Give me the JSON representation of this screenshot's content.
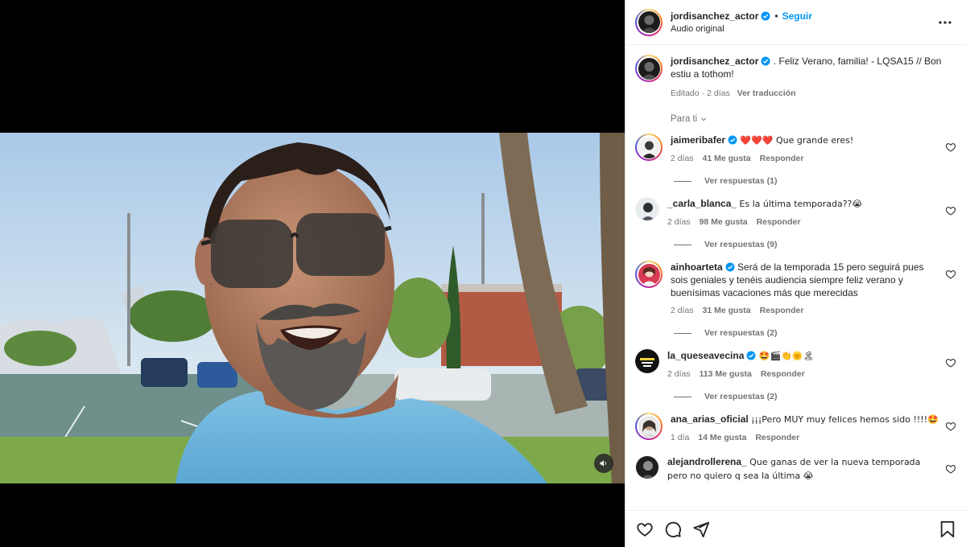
{
  "post": {
    "author": "jordisanchez_actor",
    "follow_label": "Seguir",
    "separator": "•",
    "audio": "Audio original",
    "caption": {
      "username": "jordisanchez_actor",
      "text": ". Feliz Verano, familia! - LQSA15 // Bon estiu a tothom!",
      "edited": "Editado",
      "time": "2 días",
      "translate": "Ver traducción"
    },
    "filter_label": "Para ti"
  },
  "comments": [
    {
      "username": "jaimeribafer",
      "verified": true,
      "text": "❤️❤️❤️ Que grande eres!",
      "time": "2 días",
      "likes": "41 Me gusta",
      "reply": "Responder",
      "replies": "Ver respuestas (1)"
    },
    {
      "username": "_carla_blanca_",
      "verified": false,
      "text": "Es la última temporada??😭",
      "time": "2 días",
      "likes": "98 Me gusta",
      "reply": "Responder",
      "replies": "Ver respuestas (9)"
    },
    {
      "username": "ainhoarteta",
      "verified": true,
      "text": "Será de la temporada 15 pero seguirá pues sois geniales y tenéis audiencia siempre feliz verano y buenísimas vacaciones más que merecidas",
      "time": "2 días",
      "likes": "31 Me gusta",
      "reply": "Responder",
      "replies": "Ver respuestas (2)"
    },
    {
      "username": "la_queseavecina",
      "verified": true,
      "text": "🤩🎬👏🌞🏝",
      "time": "2 días",
      "likes": "113 Me gusta",
      "reply": "Responder",
      "replies": "Ver respuestas (2)"
    },
    {
      "username": "ana_arias_oficial",
      "verified": false,
      "text": "¡¡¡Pero MUY muy felices hemos sido !!!!🤩",
      "time": "1 día",
      "likes": "14 Me gusta",
      "reply": "Responder"
    },
    {
      "username": "alejandrollerena_",
      "verified": false,
      "text": "Que ganas de ver la nueva temporada pero no quiero q sea la última 😭"
    }
  ],
  "icons": {
    "more": "more-horizontal-icon",
    "mute": "speaker-icon",
    "like": "heart-icon",
    "comment": "comment-icon",
    "share": "paper-plane-icon",
    "save": "bookmark-icon",
    "verified": "verified-badge-icon",
    "chevron": "chevron-down-icon"
  },
  "colors": {
    "link_blue": "#0095f6",
    "verified_blue": "#0095f6",
    "muted_text": "#737373"
  }
}
